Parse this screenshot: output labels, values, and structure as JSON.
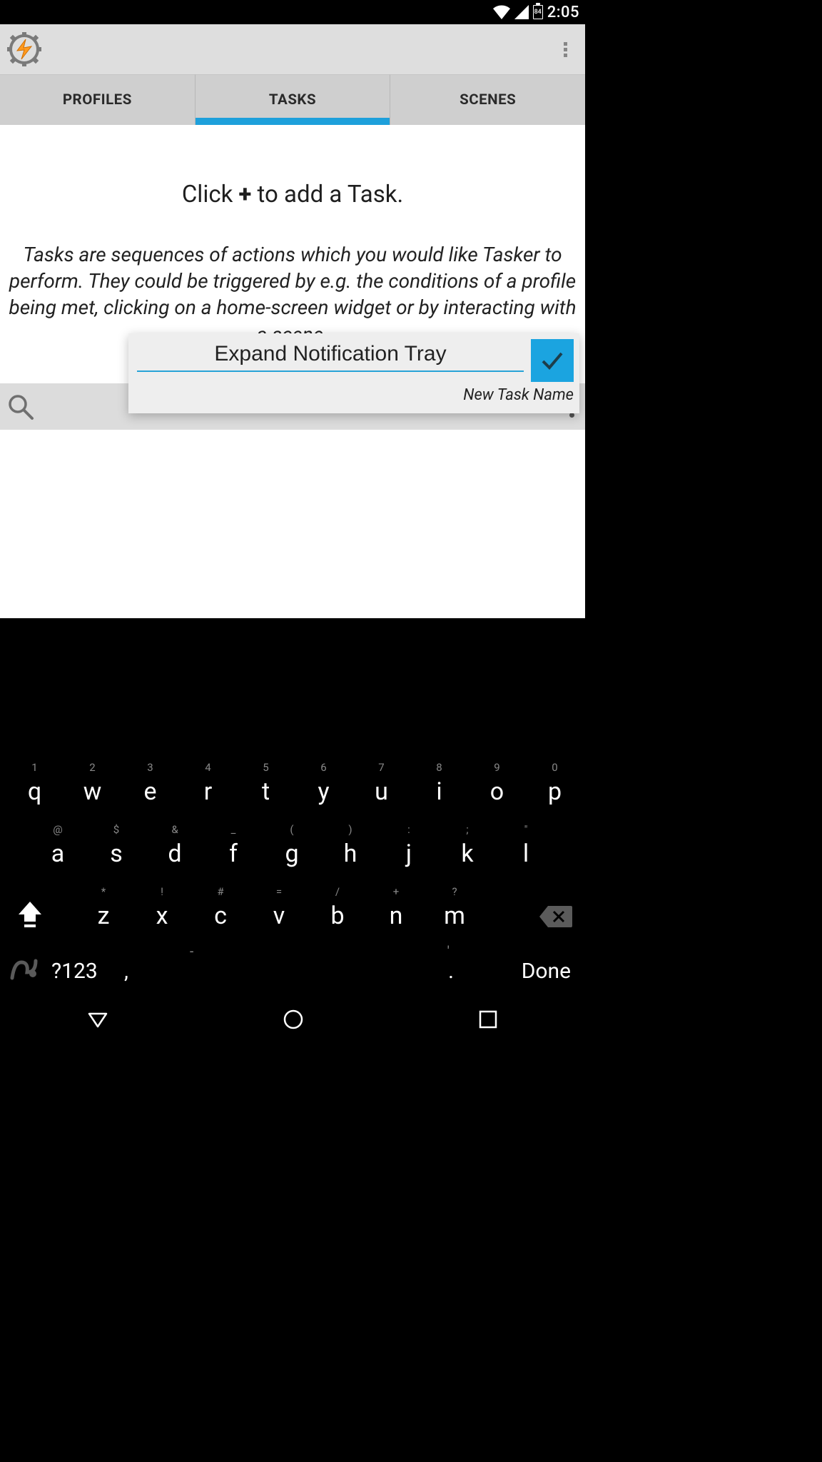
{
  "status_bar": {
    "battery_pct": "84",
    "time": "2:05"
  },
  "tabs": {
    "profiles": "PROFILES",
    "tasks": "TASKS",
    "scenes": "SCENES",
    "active_index": 1
  },
  "hint": {
    "title_pre": "Click ",
    "title_sym": "+",
    "title_post": " to add a Task.",
    "body": "Tasks are sequences of actions which you would like Tasker to perform. They could be triggered by e.g. the conditions of a profile being met, clicking on a home-screen widget or by interacting with a scene."
  },
  "dialog": {
    "input_value": "Expand Notification Tray",
    "label": "New Task Name"
  },
  "keyboard": {
    "row1_syms": [
      "1",
      "2",
      "3",
      "4",
      "5",
      "6",
      "7",
      "8",
      "9",
      "0"
    ],
    "row1": [
      "q",
      "w",
      "e",
      "r",
      "t",
      "y",
      "u",
      "i",
      "o",
      "p"
    ],
    "row2_syms": [
      "@",
      "$",
      "&",
      "_",
      "(",
      ")",
      ":",
      ";",
      "\""
    ],
    "row2": [
      "a",
      "s",
      "d",
      "f",
      "g",
      "h",
      "j",
      "k",
      "l"
    ],
    "row3_syms": [
      "*",
      "!",
      "#",
      "=",
      "/",
      "+",
      "?"
    ],
    "row3": [
      "z",
      "x",
      "c",
      "v",
      "b",
      "n",
      "m"
    ],
    "num_toggle": "?123",
    "done": "Done"
  }
}
